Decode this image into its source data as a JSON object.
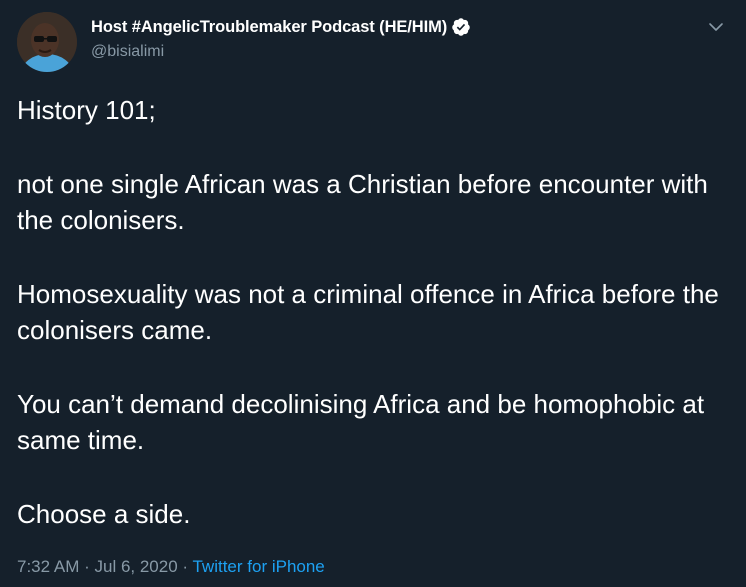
{
  "author": {
    "display_name": "Host #AngelicTroublemaker Podcast (HE/HIM)",
    "handle": "@bisialimi",
    "verified": true,
    "avatar_icon": "avatar-photo"
  },
  "tweet": {
    "paragraphs": [
      "History 101;",
      "not one single African was a Christian before encounter with the colonisers.",
      "Homosexuality was not a criminal offence in Africa before the colonisers came.",
      "You can’t demand decolinising Africa and be homophobic at same time.",
      "Choose a side."
    ],
    "time": "7:32 AM",
    "separator_1": " · ",
    "date": "Jul 6, 2020",
    "separator_2": " · ",
    "source": "Twitter for iPhone"
  },
  "colors": {
    "background": "#15202b",
    "text_primary": "#ffffff",
    "text_secondary": "#8899a6",
    "accent": "#1da1f2"
  }
}
